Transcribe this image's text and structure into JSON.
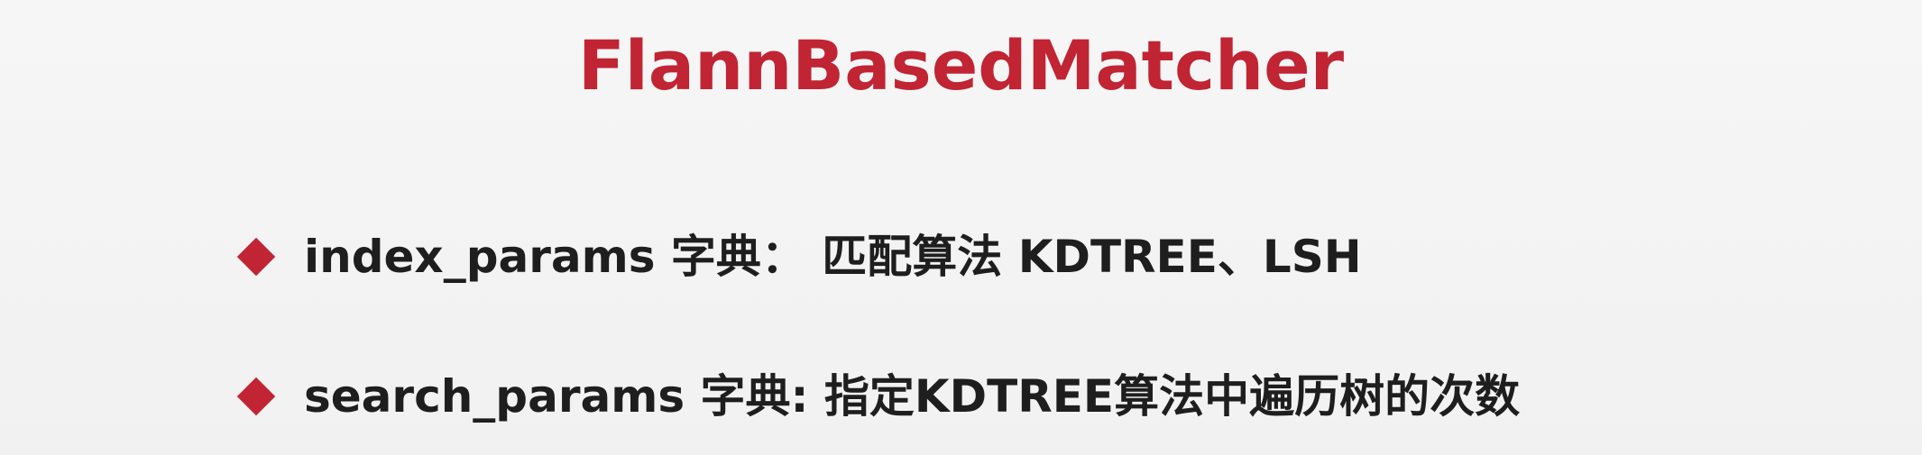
{
  "slide": {
    "title": "FlannBasedMatcher",
    "bullets": [
      {
        "text": "index_params 字典： 匹配算法 KDTREE、LSH"
      },
      {
        "text": "search_params 字典: 指定KDTREE算法中遍历树的次数"
      }
    ]
  },
  "icons": {
    "bullet_marker": "diamond-icon"
  },
  "colors": {
    "accent": "#c12433",
    "text": "#1e1e1e",
    "background": "#f4f4f4"
  }
}
